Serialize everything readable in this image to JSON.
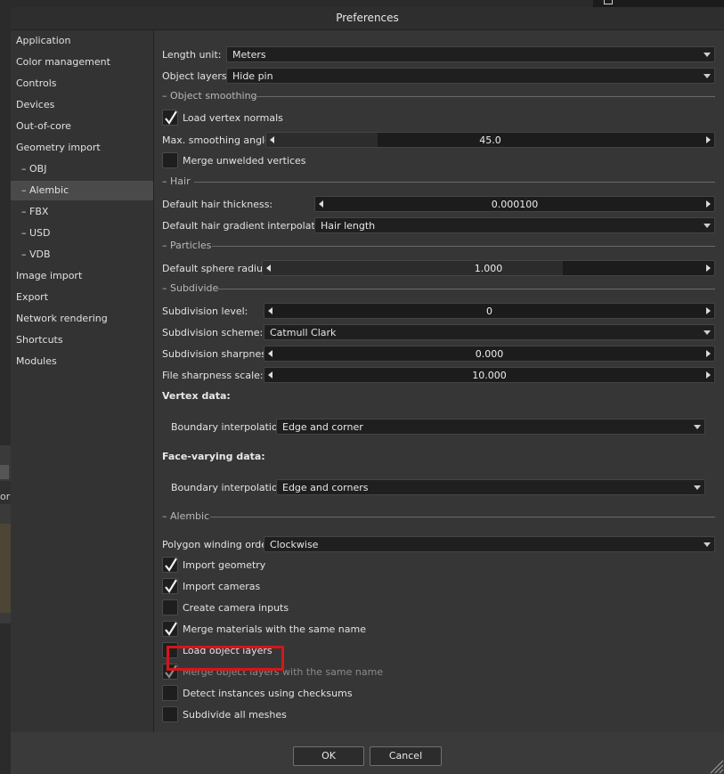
{
  "window": {
    "title": "Preferences"
  },
  "sidebar": {
    "items": [
      {
        "label": "Application"
      },
      {
        "label": "Color management"
      },
      {
        "label": "Controls"
      },
      {
        "label": "Devices"
      },
      {
        "label": "Out-of-core"
      },
      {
        "label": "Geometry import"
      },
      {
        "label": "– OBJ"
      },
      {
        "label": "– Alembic",
        "selected": true
      },
      {
        "label": "– FBX"
      },
      {
        "label": "– USD"
      },
      {
        "label": "– VDB"
      },
      {
        "label": "Image import"
      },
      {
        "label": "Export"
      },
      {
        "label": "Network rendering"
      },
      {
        "label": "Shortcuts"
      },
      {
        "label": "Modules"
      }
    ]
  },
  "general": {
    "length_unit_label": "Length unit:",
    "length_unit_value": "Meters",
    "object_layers_label": "Object layers:",
    "object_layers_value": "Hide pin"
  },
  "object_smoothing": {
    "section": "– Object smoothing",
    "load_vertex_normals": {
      "label": "Load vertex normals",
      "checked": true
    },
    "max_angle_label": "Max. smoothing angle:",
    "max_angle_value": "45.0",
    "merge_unwelded": {
      "label": "Merge unwelded vertices",
      "checked": false
    }
  },
  "hair": {
    "section": "– Hair",
    "thickness_label": "Default hair thickness:",
    "thickness_value": "0.000100",
    "gradient_label": "Default hair gradient interpolation:",
    "gradient_value": "Hair length"
  },
  "particles": {
    "section": "– Particles",
    "radius_label": "Default sphere radius:",
    "radius_value": "1.000"
  },
  "subdivide": {
    "section": "– Subdivide",
    "level_label": "Subdivision level:",
    "level_value": "0",
    "scheme_label": "Subdivision scheme:",
    "scheme_value": "Catmull Clark",
    "sharpness_label": "Subdivision sharpness:",
    "sharpness_value": "0.000",
    "file_sharpness_label": "File sharpness scale:",
    "file_sharpness_value": "10.000",
    "vertex_data_heading": "Vertex data:",
    "vertex_boundary_label": "Boundary interpolation:",
    "vertex_boundary_value": "Edge and corner",
    "face_data_heading": "Face-varying data:",
    "face_boundary_label": "Boundary interpolation:",
    "face_boundary_value": "Edge and corners"
  },
  "alembic": {
    "section": "– Alembic",
    "winding_label": "Polygon winding order:",
    "winding_value": "Clockwise",
    "checkboxes": [
      {
        "label": "Import geometry",
        "checked": true
      },
      {
        "label": "Import cameras",
        "checked": true
      },
      {
        "label": "Create camera inputs",
        "checked": false
      },
      {
        "label": "Merge materials with the same name",
        "checked": true
      },
      {
        "label": "Load object layers",
        "checked": false,
        "highlighted": true
      },
      {
        "label": "Merge object layers with the same name",
        "checked": true,
        "disabled": true
      },
      {
        "label": "Detect instances using checksums",
        "checked": false
      },
      {
        "label": "Subdivide all meshes",
        "checked": false
      }
    ]
  },
  "footer": {
    "ok_label": "OK",
    "cancel_label": "Cancel"
  },
  "colors": {
    "highlight": "#d3161b",
    "dialog_bg": "#3a3a3a",
    "field_bg": "#1e1e1e"
  }
}
